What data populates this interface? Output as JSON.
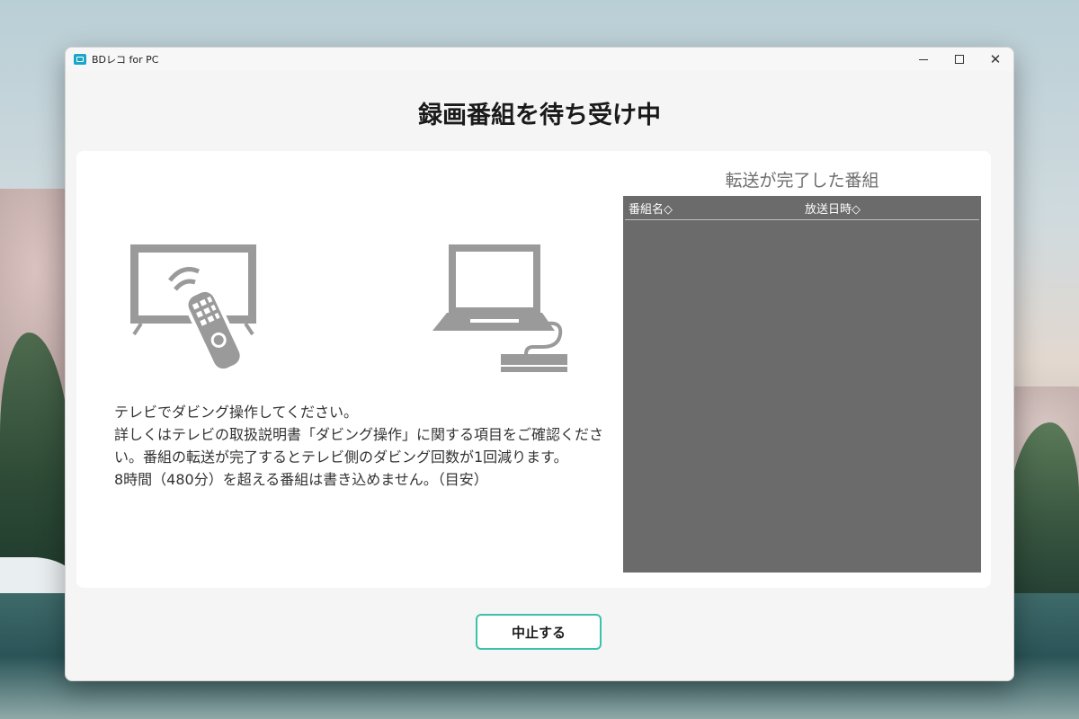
{
  "window": {
    "title": "BDレコ for PC"
  },
  "main": {
    "heading": "録画番組を待ち受け中",
    "instructions": [
      "テレビでダビング操作してください。",
      "詳しくはテレビの取扱説明書「ダビング操作」に関する項目をご確認ください。番組の転送が完了するとテレビ側のダビング回数が1回減ります。",
      "8時間（480分）を超える番組は書き込めません。（目安）"
    ]
  },
  "transfer_list": {
    "title": "転送が完了した番組",
    "columns": [
      "番組名◇",
      "放送日時◇"
    ],
    "rows": []
  },
  "actions": {
    "stop_label": "中止する"
  },
  "icons": {
    "tv": "tv-remote-icon",
    "pc": "laptop-drive-icon"
  },
  "colors": {
    "accent": "#3bc2a8",
    "table_bg": "#6b6b6b",
    "icon_gray": "#9a9a9a"
  }
}
